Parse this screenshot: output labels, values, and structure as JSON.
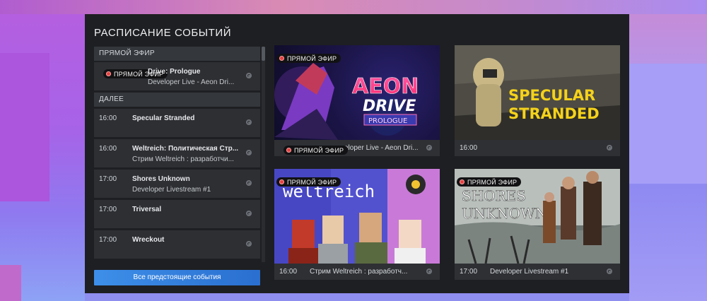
{
  "title": "РАСПИСАНИЕ СОБЫТИЙ",
  "live_label": "ПРЯМОЙ ЭФИР",
  "sections": {
    "live": "ПРЯМОЙ ЭФИР",
    "next": "ДАЛЕЕ"
  },
  "live_event": {
    "name": "Aeon Drive: Prologue",
    "visible_name": "Drive: Prologue",
    "sub": "Developer Live - Aeon Dri..."
  },
  "upcoming": [
    {
      "time": "16:00",
      "name": "Specular Stranded",
      "sub": ""
    },
    {
      "time": "16:00",
      "name": "Weltreich: Политическая Стр...",
      "sub": "Стрим Weltreich : разработчи..."
    },
    {
      "time": "17:00",
      "name": "Shores Unknown",
      "sub": "Developer Livestream #1"
    },
    {
      "time": "17:00",
      "name": "Triversal",
      "sub": ""
    },
    {
      "time": "17:00",
      "name": "Wreckout",
      "sub": ""
    }
  ],
  "all_events_button": "Все предстоящие события",
  "cards": [
    {
      "art": "AEON DRIVE PROLOGUE",
      "art_l1": "AEON",
      "art_l2": "DRIVE",
      "art_l3": "PROLOGUE",
      "time": "",
      "sub": "Developer Live - Aeon Dri...",
      "sub_visible": "veloper Live - Aeon Dri...",
      "live": true
    },
    {
      "art": "SPECULAR STRANDED",
      "art_l1": "SPECULAR",
      "art_l2": "STRANDED",
      "time": "16:00",
      "sub": "",
      "live": false
    },
    {
      "art": "weltreich",
      "art_l1": "weltreich",
      "time": "16:00",
      "sub": "Стрим Weltreich : разработч...",
      "live": true
    },
    {
      "art": "SHORES UNKNOWN",
      "art_l1": "SHORES",
      "art_l2": "UNKNOWN",
      "time": "17:00",
      "sub": "Developer Livestream #1",
      "live": true
    }
  ],
  "colors": {
    "accent": "#2f7fe0",
    "live_dot": "#e64040",
    "panel": "#1e1f22"
  }
}
